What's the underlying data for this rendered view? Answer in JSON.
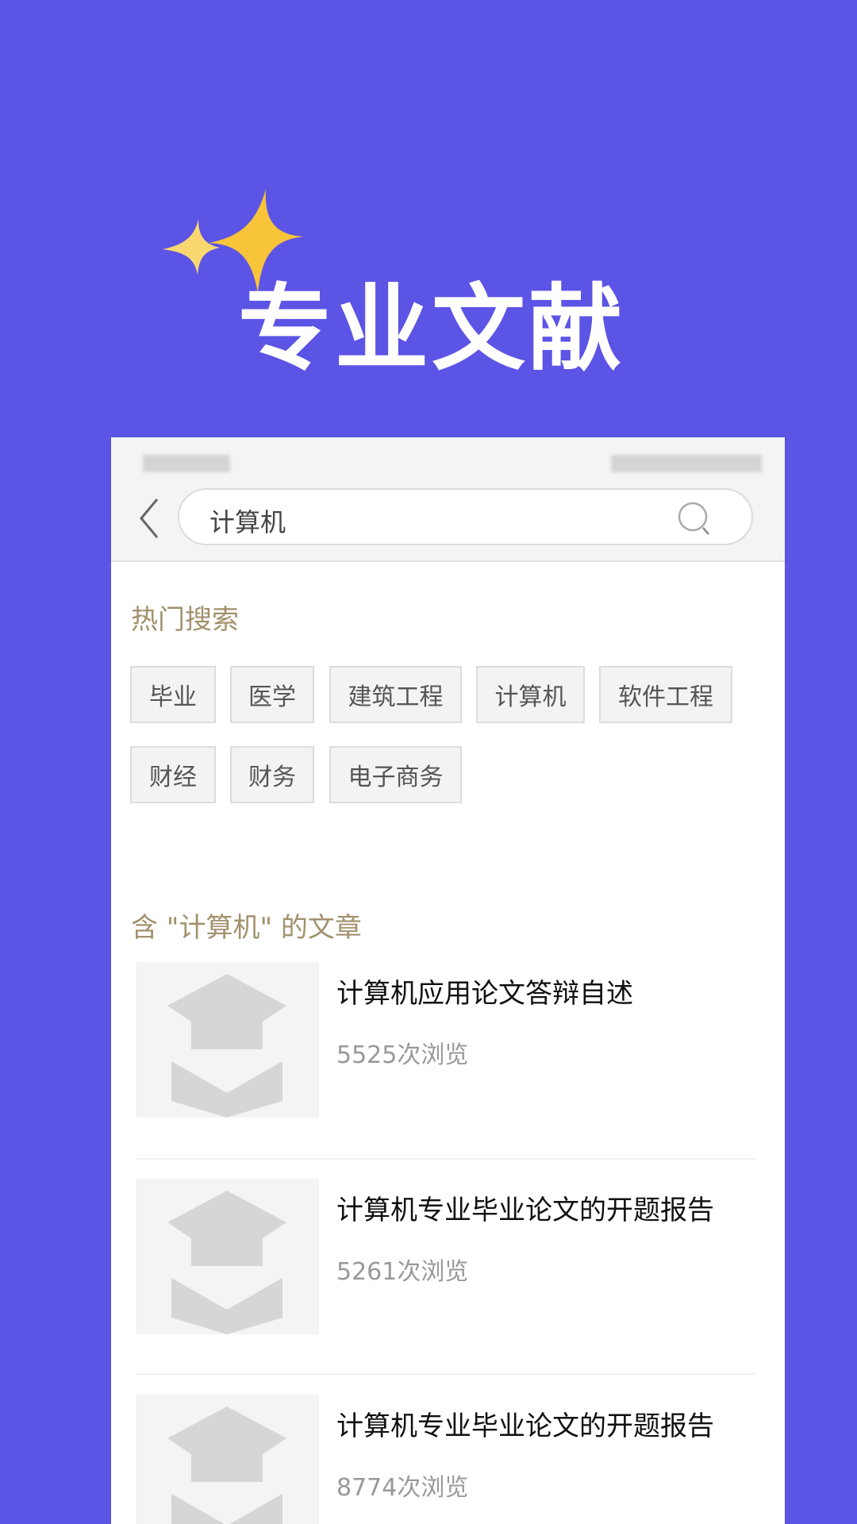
{
  "hero": {
    "title": "专业文献"
  },
  "colors": {
    "background": "#5c54e5",
    "section_header": "#a2916c"
  },
  "search": {
    "value": "计算机",
    "back_icon": "chevron-left-icon",
    "search_icon": "search-icon"
  },
  "hot": {
    "heading": "热门搜索",
    "tags": [
      "毕业",
      "医学",
      "建筑工程",
      "计算机",
      "软件工程",
      "财经",
      "财务",
      "电子商务"
    ]
  },
  "results": {
    "heading": "含 \"计算机\" 的文章",
    "items": [
      {
        "title": "计算机应用论文答辩自述",
        "views": "5525次浏览"
      },
      {
        "title": "计算机专业毕业论文的开题报告",
        "views": "5261次浏览"
      },
      {
        "title": "计算机专业毕业论文的开题报告",
        "views": "8774次浏览"
      }
    ]
  }
}
